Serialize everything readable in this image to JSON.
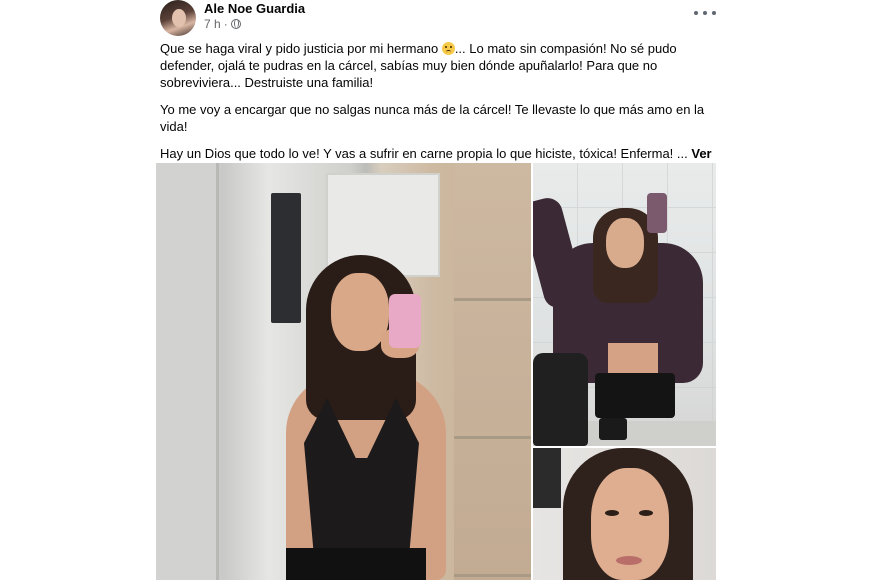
{
  "post": {
    "author": "Ale Noe Guardia",
    "time": "7 h",
    "separator": "·",
    "more_icon": "more-horizontal-icon",
    "privacy_icon": "globe-icon",
    "paragraphs": [
      {
        "before_emoji": "Que se haga viral y pido justicia por mi hermano ",
        "emoji": "crying-face-emoji",
        "after_emoji": "... Lo mato sin compasión! No sé pudo defender, ojalá te pudras en la cárcel, sabías muy bien dónde apuñalarlo! Para que no sobreviviera... Destruiste una familia!"
      },
      {
        "text": "Yo me voy a encargar que no salgas nunca más de la cárcel! Te llevaste lo que más amo en la vida!"
      },
      {
        "text": "Hay un Dios que todo lo ve! Y vas a sufrir en carne propia lo que hiciste, tóxica! Enferma! ... "
      }
    ],
    "see_more": "Ver más"
  },
  "photos": [
    "mirror-selfie",
    "mirror-selfie-jacket",
    "close-up-portrait"
  ]
}
